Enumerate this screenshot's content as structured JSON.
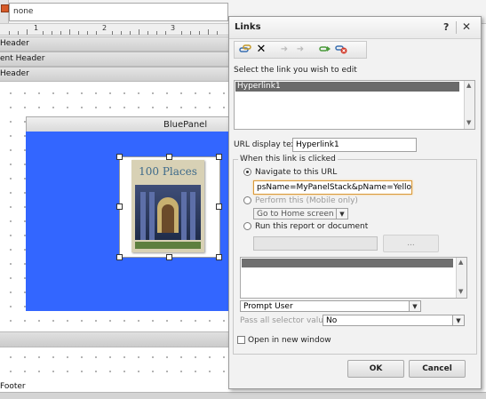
{
  "designer": {
    "top_field_value": "none",
    "ruler_numbers": [
      "1",
      "2",
      "3"
    ],
    "bands": [
      "Header",
      "ent Header",
      "Header"
    ],
    "panel_title": "BluePanel",
    "book_title": "100 Places",
    "footer_label": "Footer"
  },
  "dialog": {
    "title": "Links",
    "help_label": "?",
    "close_label": "✕",
    "toolbar": {
      "add_icon": "add-link-icon",
      "delete_icon": "delete-icon",
      "move_up_icon": "move-up-icon",
      "move_down_icon": "move-down-icon",
      "edit_icon": "edit-link-icon",
      "remove_icon": "remove-link-icon"
    },
    "select_link_label": "Select the link you wish to edit",
    "links": [
      "Hyperlink1"
    ],
    "url_display_label": "URL display text",
    "url_display_value": "Hyperlink1",
    "when_clicked_label": "When this link is clicked",
    "navigate_label": "Navigate to this URL",
    "navigate_value": "psName=MyPanelStack&pName=YellowPanel",
    "perform_label": "Perform this (Mobile only)",
    "perform_select": "Go to Home screen",
    "run_report_label": "Run this report or document",
    "browse_button": "...",
    "prompt_select": "Prompt User",
    "pass_selector_label": "Pass all selector values:",
    "pass_selector_value": "No",
    "open_new_window_label": "Open in new window",
    "ok_button": "OK",
    "cancel_button": "Cancel",
    "colors": {
      "panel_blue": "#3366ff",
      "selection_grey": "#6a6a6a"
    }
  }
}
